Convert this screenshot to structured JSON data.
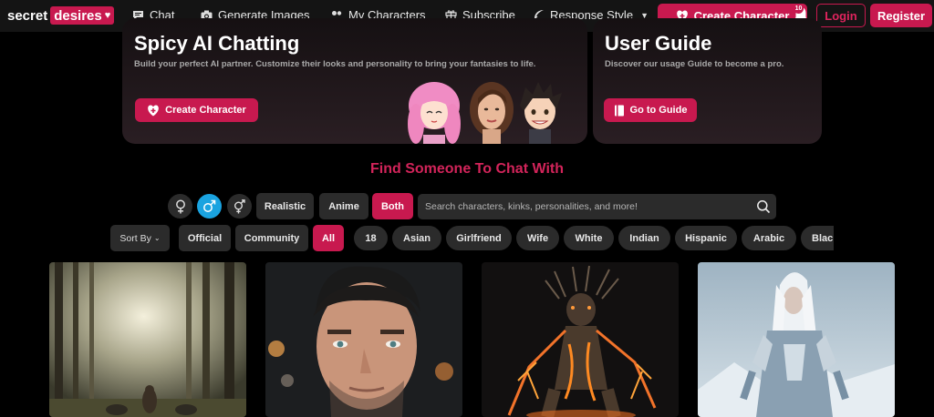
{
  "nav": {
    "logo_word1": "secret",
    "logo_word2": "desires",
    "links": [
      {
        "label": "Chat",
        "icon": "chat-icon"
      },
      {
        "label": "Generate Images",
        "icon": "camera-icon"
      },
      {
        "label": "My Characters",
        "icon": "users-icon"
      },
      {
        "label": "Subscribe",
        "icon": "gift-icon"
      },
      {
        "label": "Response Style",
        "icon": "feather-icon"
      }
    ],
    "create_label": "Create Character",
    "notification_count": "10",
    "login_label": "Login",
    "register_label": "Register"
  },
  "hero": {
    "card1": {
      "title": "Spicy AI Chatting",
      "description": "Build your perfect AI partner. Customize their looks and personality to bring your fantasies to life.",
      "button": "Create Character"
    },
    "card2": {
      "title": "User Guide",
      "description": "Discover our usage Guide to become a pro.",
      "button": "Go to Guide"
    }
  },
  "section_title": "Find Someone To Chat With",
  "filters": {
    "genders": [
      "female",
      "male",
      "other"
    ],
    "active_gender": "male",
    "styles": [
      "Realistic",
      "Anime",
      "Both"
    ],
    "active_style": "Both",
    "search_placeholder": "Search characters, kinks, personalities, and more!",
    "sort_label": "Sort By",
    "sources": [
      "Official",
      "Community",
      "All"
    ],
    "active_source": "All",
    "tags": [
      "18",
      "Asian",
      "Girlfriend",
      "Wife",
      "White",
      "Indian",
      "Hispanic",
      "Arabic",
      "Black"
    ]
  },
  "colors": {
    "accent": "#c8194f",
    "active_gender": "#1aa3e0",
    "chip_bg": "#2b2b2b",
    "background": "#000000"
  }
}
